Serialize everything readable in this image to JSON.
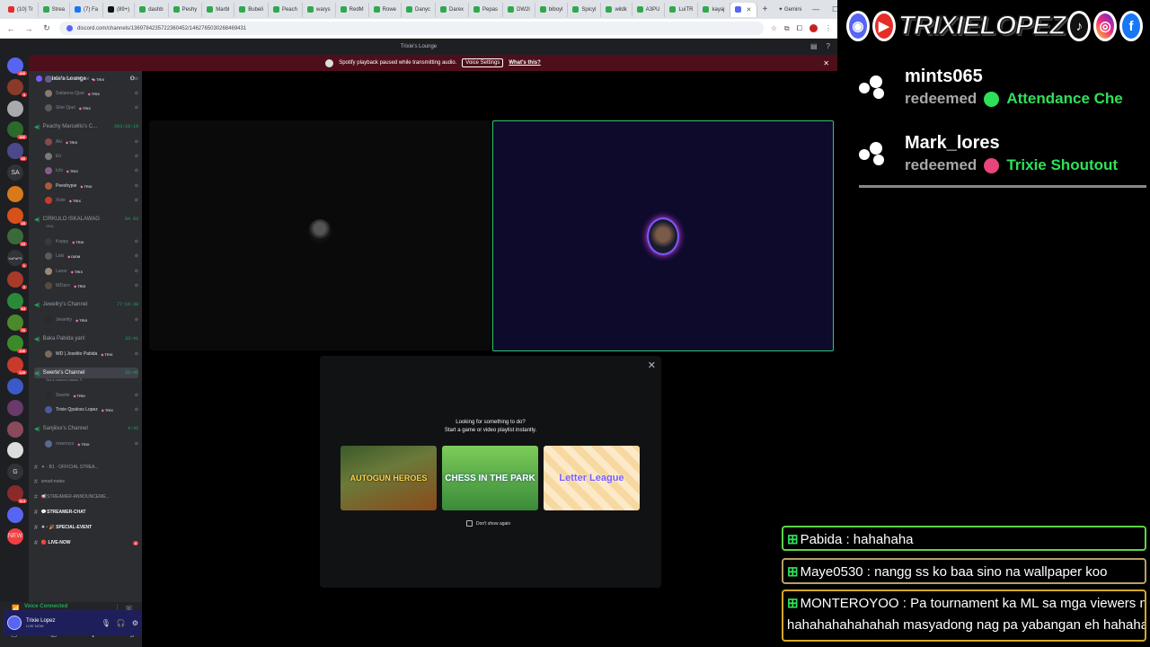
{
  "browser": {
    "tabs": [
      {
        "label": "(10) Tr",
        "color": "#e52d27"
      },
      {
        "label": "Strea",
        "color": "#2fa84f"
      },
      {
        "label": "(7) Fa",
        "color": "#1877f2"
      },
      {
        "label": "(89+) ",
        "color": "#111111"
      },
      {
        "label": "dashb",
        "color": "#2fa84f"
      },
      {
        "label": "Peshy",
        "color": "#2fa84f"
      },
      {
        "label": "Marbl",
        "color": "#2fa84f"
      },
      {
        "label": "Bubeli",
        "color": "#2fa84f"
      },
      {
        "label": "Peach",
        "color": "#2fa84f"
      },
      {
        "label": "warys",
        "color": "#2fa84f"
      },
      {
        "label": "RedM",
        "color": "#2fa84f"
      },
      {
        "label": "Rowe",
        "color": "#2fa84f"
      },
      {
        "label": "Danyc",
        "color": "#2fa84f"
      },
      {
        "label": "Darex",
        "color": "#2fa84f"
      },
      {
        "label": "Pepas",
        "color": "#2fa84f"
      },
      {
        "label": "DW2l",
        "color": "#2fa84f"
      },
      {
        "label": "biboyl",
        "color": "#2fa84f"
      },
      {
        "label": "Spicyl",
        "color": "#2fa84f"
      },
      {
        "label": "wildk",
        "color": "#2fa84f"
      },
      {
        "label": "A3PU",
        "color": "#2fa84f"
      },
      {
        "label": "LuiTR",
        "color": "#2fa84f"
      },
      {
        "label": "kayaj",
        "color": "#2fa84f"
      },
      {
        "label": "",
        "color": "#5865f2",
        "active": true
      }
    ],
    "gemini_label": "Gemini",
    "url": "discord.com/channels/1369784235722360452/1462765030268469431"
  },
  "discord": {
    "window_title": "Trixie's Lounge",
    "notice": {
      "text": "Spotify playback paused while transmitting audio.",
      "button": "Voice Settings",
      "link": "What's this?"
    },
    "server_name": "Trixie's Lounge",
    "voice_channels": [
      {
        "name": "Peachy Marcellis's C...",
        "time": "203:18:19"
      },
      {
        "name": "CIRKULO ISKALAWAG",
        "time": "04 03",
        "sub": "ORA"
      },
      {
        "name": "Jewellry's Channel",
        "time": "77:16:38"
      },
      {
        "name": "Baka Pabida yan!",
        "time": "33:41"
      },
      {
        "name": "Swerte's Channel",
        "time": "26:46",
        "sub": "Set a channel status ✎",
        "selected": true
      },
      {
        "name": "Sanjiiixx's Channel",
        "time": "4:45"
      }
    ],
    "voice_users": [
      {
        "name": "Monseratto Qpal",
        "tag": "TRIX"
      },
      {
        "name": "Satianna Qpal",
        "tag": "TRIX"
      },
      {
        "name": "Skie Qpal",
        "tag": "TRIX"
      },
      {
        "name": "Aki",
        "tag": "TRIX"
      },
      {
        "name": "Eri",
        "tag": ""
      },
      {
        "name": "Ichi",
        "tag": "TRIX"
      },
      {
        "name": "Peeshypie",
        "tag": "TRIX"
      },
      {
        "name": "Xixie",
        "tag": "TRIX"
      },
      {
        "name": "Koppy",
        "tag": "TRIX"
      },
      {
        "name": "Laki",
        "tag": "DIEM"
      },
      {
        "name": "Laner",
        "tag": "TRIX"
      },
      {
        "name": "WDarrr",
        "tag": "TRIX"
      },
      {
        "name": "Jewellry",
        "tag": "TRIX"
      },
      {
        "name": "WD | Joselito Pabida",
        "tag": "TRIX"
      },
      {
        "name": "Swerte",
        "tag": "TRIX"
      },
      {
        "name": "Trixie Qpaloss Lopez",
        "tag": "TRIX"
      },
      {
        "name": "rowenrys",
        "tag": "TRIX"
      }
    ],
    "text_channels": [
      {
        "name": "✦ · B1 · OFFICIAL STREA..."
      },
      {
        "name": "smod-notes"
      },
      {
        "name": "📢STREAMER-ANNOUNCEME..."
      },
      {
        "name": "💬STREAMER-CHAT",
        "bold": true
      },
      {
        "name": "✦ · 🎉 SPECIAL-EVENT",
        "bold": true
      },
      {
        "name": "🔴 LIVE-NOW",
        "bold": true,
        "badge": "4"
      }
    ],
    "voice_panel": {
      "status": "Voice Connected",
      "channel": "Swerte's Channel / Trixie's Lounge"
    },
    "user_panel": {
      "name": "Trixie Lopez",
      "status": "LIVE NOW"
    },
    "guilds": [
      {
        "text": "",
        "badge": "409",
        "color": "#5865f2"
      },
      {
        "text": "",
        "badge": "4",
        "color": "#8a3a2a"
      },
      {
        "text": "",
        "badge": "",
        "color": "#aaaaaa"
      },
      {
        "text": "",
        "badge": "336",
        "color": "#2a6a2a"
      },
      {
        "text": "",
        "badge": "60",
        "color": "#4a4a8a"
      },
      {
        "text": "SA",
        "badge": "",
        "color": "#313338"
      },
      {
        "text": "",
        "badge": "",
        "color": "#d87a1a"
      },
      {
        "text": "",
        "badge": "28",
        "color": "#d8501a"
      },
      {
        "text": "",
        "badge": "29",
        "color": "#3a6a3a"
      },
      {
        "text": "KaPaPS",
        "badge": "1",
        "color": "#313338"
      },
      {
        "text": "",
        "badge": "2",
        "color": "#a83a2a"
      },
      {
        "text": "",
        "badge": "64",
        "color": "#2a8a3a"
      },
      {
        "text": "",
        "badge": "76",
        "color": "#4a8a2a"
      },
      {
        "text": "",
        "badge": "106",
        "color": "#3a8a2a"
      },
      {
        "text": "",
        "badge": "120",
        "color": "#c83a2a"
      },
      {
        "text": "",
        "badge": "",
        "color": "#3a5ac8"
      },
      {
        "text": "",
        "badge": "",
        "color": "#6a3a6a"
      },
      {
        "text": "",
        "badge": "",
        "color": "#8a4a5a"
      },
      {
        "text": "",
        "badge": "",
        "color": "#dddddd"
      },
      {
        "text": "G",
        "badge": "",
        "color": "#313338"
      },
      {
        "text": "",
        "badge": "114",
        "color": "#8a2a2a"
      },
      {
        "text": "",
        "badge": "",
        "color": "#5865f2"
      },
      {
        "text": "NEW",
        "badge": "",
        "color": "#f23f42"
      }
    ],
    "activity": {
      "title": "Looking for something to do?",
      "subtitle": "Start a game or video playlist instantly.",
      "games": [
        "AUTOGUN HEROES",
        "CHESS IN THE PARK",
        "Letter League"
      ],
      "checkbox": "Don't show again"
    }
  },
  "overlay": {
    "brand": "TRIXIELOPEZ",
    "redemptions": [
      {
        "user": "mints065",
        "label": "redeemed",
        "reward": "Attendance Che",
        "dot_color": "#2fe05a"
      },
      {
        "user": "Mark_lores",
        "label": "redeemed",
        "reward": "Trixie Shoutout",
        "dot_color": "#e8457a"
      }
    ],
    "chat": [
      {
        "text": "Pabida : hahahaha"
      },
      {
        "text": "Maye0530 : nangg ss ko baa sino na wallpaper koo"
      },
      {
        "text": "MONTEROYOO : Pa tournament ka ML sa mga viewers nang",
        "cont": "hahahahahahahah masyadong nag pa yabangan eh hahaha"
      }
    ]
  }
}
